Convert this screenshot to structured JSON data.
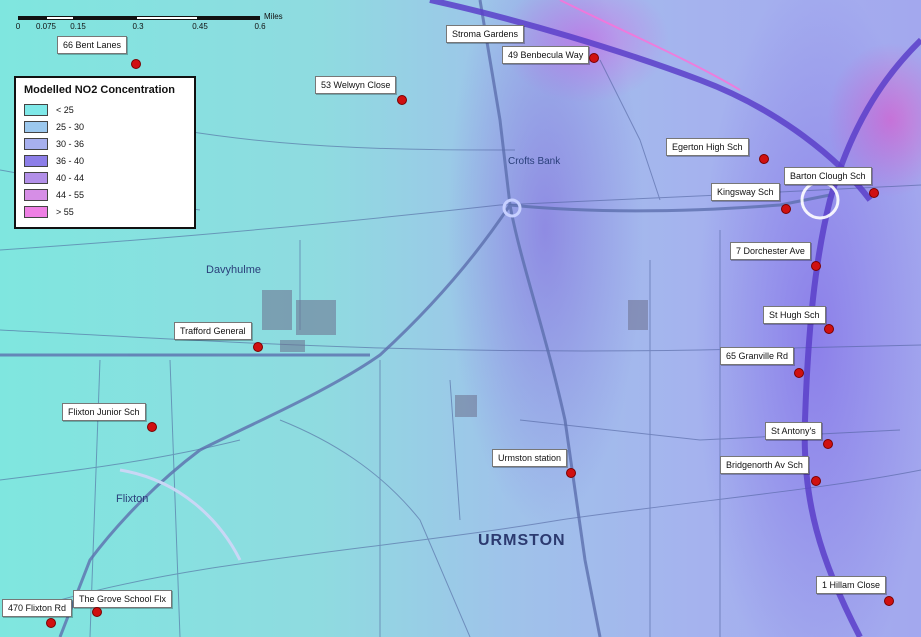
{
  "scale_bar": {
    "ticks": [
      "0",
      "0.075",
      "0.15",
      "0.3",
      "0.45",
      "0.6"
    ],
    "unit": "Miles"
  },
  "legend": {
    "title": "Modelled NO2 Concentration",
    "classes": [
      {
        "label": "< 25",
        "color": "#7fe8e8"
      },
      {
        "label": "25 - 30",
        "color": "#9cc8ee"
      },
      {
        "label": "30 - 36",
        "color": "#a7b0ef"
      },
      {
        "label": "36 - 40",
        "color": "#8c7ee8"
      },
      {
        "label": "40 - 44",
        "color": "#b28fe8"
      },
      {
        "label": "44 - 55",
        "color": "#d68ee6"
      },
      {
        "label": "> 55",
        "color": "#ee7fe4"
      }
    ]
  },
  "sites": {
    "bent_lanes": "66 Bent Lanes",
    "stroma_gardens": "Stroma Gardens",
    "benbecula_way": "49 Benbecula Way",
    "welwyn_close": "53 Welwyn Close",
    "egerton_high": "Egerton High Sch",
    "barton_clough": "Barton Clough Sch",
    "kingsway": "Kingsway Sch",
    "dorchester_ave": "7 Dorchester Ave",
    "trafford_general": "Trafford General",
    "st_hugh": "St Hugh Sch",
    "granville_rd": "65 Granville Rd",
    "flixton_junior": "Flixton Junior Sch",
    "st_antonys": "St Antony's",
    "urmston_station": "Urmston station",
    "bridgenorth": "Bridgenorth Av Sch",
    "hillam_close": "1 Hillam Close",
    "flixton_rd": "470 Flixton Rd",
    "grove_school": "The Grove School Flx"
  },
  "places": {
    "urmston": "URMSTON",
    "flixton": "Flixton",
    "davyhulme": "Davyhulme",
    "crofts_bank": "Crofts Bank"
  },
  "colors": {
    "site_marker": "#d01010",
    "motorway": "#5b3fc9",
    "road": "#4a5d99"
  }
}
